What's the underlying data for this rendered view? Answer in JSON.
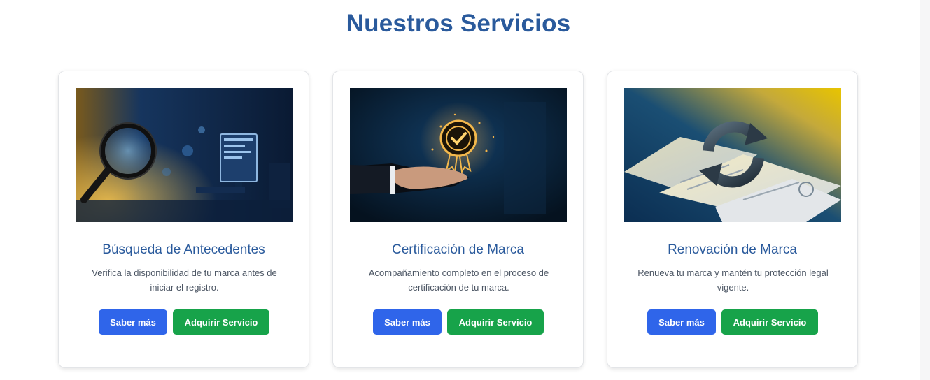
{
  "section": {
    "title": "Nuestros Servicios"
  },
  "services": [
    {
      "title": "Búsqueda de Antecedentes",
      "description": "Verifica la disponibilidad de tu marca antes de iniciar el registro.",
      "more_label": "Saber más",
      "buy_label": "Adquirir Servicio",
      "image": "magnifying-glass-search-photo"
    },
    {
      "title": "Certificación de Marca",
      "description": "Acompañamiento completo en el proceso de certificación de tu marca.",
      "more_label": "Saber más",
      "buy_label": "Adquirir Servicio",
      "image": "certificate-badge-hand-photo"
    },
    {
      "title": "Renovación de Marca",
      "description": "Renueva tu marca y mantén tu protección legal vigente.",
      "more_label": "Saber más",
      "buy_label": "Adquirir Servicio",
      "image": "renewal-arrows-documents-photo"
    }
  ],
  "colors": {
    "title": "#2a5a9c",
    "primary_button": "#2f65ea",
    "success_button": "#17a34a"
  }
}
